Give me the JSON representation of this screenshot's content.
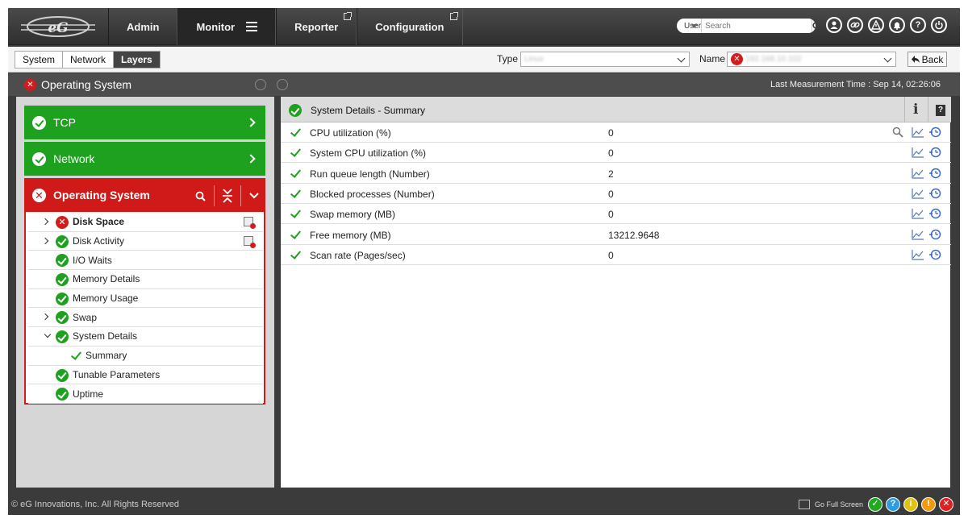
{
  "app": {
    "brand": "eG"
  },
  "nav": {
    "items": [
      {
        "label": "Admin",
        "active": false,
        "external": false
      },
      {
        "label": "Monitor",
        "active": true,
        "external": false
      },
      {
        "label": "Reporter",
        "active": false,
        "external": true
      },
      {
        "label": "Configuration",
        "active": false,
        "external": true
      }
    ],
    "search_scope": "User",
    "search_placeholder": "Search",
    "icons": [
      "user-icon",
      "link-icon",
      "alert-triangle-icon",
      "bell-icon",
      "help-icon",
      "power-icon"
    ]
  },
  "subbar": {
    "tabs": [
      {
        "label": "System",
        "active": false
      },
      {
        "label": "Network",
        "active": false
      },
      {
        "label": "Layers",
        "active": true
      }
    ],
    "type_label": "Type",
    "type_value": "Linux",
    "name_label": "Name",
    "name_value": "192.168.10.102",
    "back_label": "Back"
  },
  "layer_bar": {
    "title": "Operating System",
    "status": "error",
    "measurement_time": "Last Measurement Time : Sep 14, 02:26:06"
  },
  "layers": [
    {
      "label": "TCP",
      "status": "ok"
    },
    {
      "label": "Network",
      "status": "ok"
    }
  ],
  "expanded_layer": {
    "label": "Operating System",
    "status": "error",
    "tests": [
      {
        "label": "Disk Space",
        "status": "error",
        "expander": "right",
        "bold": true,
        "has_action": true
      },
      {
        "label": "Disk Activity",
        "status": "ok",
        "expander": "right",
        "bold": false,
        "has_action": true
      },
      {
        "label": "I/O Waits",
        "status": "ok",
        "expander": "none",
        "bold": false,
        "has_action": false
      },
      {
        "label": "Memory Details",
        "status": "ok",
        "expander": "none",
        "bold": false,
        "has_action": false
      },
      {
        "label": "Memory Usage",
        "status": "ok",
        "expander": "none",
        "bold": false,
        "has_action": false
      },
      {
        "label": "Swap",
        "status": "ok",
        "expander": "right",
        "bold": false,
        "has_action": false
      },
      {
        "label": "System Details",
        "status": "ok",
        "expander": "down",
        "bold": false,
        "has_action": false
      },
      {
        "label": "Summary",
        "status": "tick",
        "expander": "none",
        "bold": false,
        "has_action": false,
        "child": true
      },
      {
        "label": "Tunable Parameters",
        "status": "ok",
        "expander": "none",
        "bold": false,
        "has_action": false
      },
      {
        "label": "Uptime",
        "status": "ok",
        "expander": "none",
        "bold": false,
        "has_action": false
      }
    ]
  },
  "details": {
    "title": "System Details - Summary",
    "measures": [
      {
        "name": "CPU utilization (%)",
        "value": "0",
        "has_search": true
      },
      {
        "name": "System CPU utilization (%)",
        "value": "0",
        "has_search": false
      },
      {
        "name": "Run queue length (Number)",
        "value": "2",
        "has_search": false
      },
      {
        "name": "Blocked processes (Number)",
        "value": "0",
        "has_search": false
      },
      {
        "name": "Swap memory (MB)",
        "value": "0",
        "has_search": false
      },
      {
        "name": "Free memory (MB)",
        "value": "13212.9648",
        "has_search": false
      },
      {
        "name": "Scan rate (Pages/sec)",
        "value": "0",
        "has_search": false
      }
    ]
  },
  "footer": {
    "copyright": "© eG Innovations, Inc. All Rights Reserved",
    "fullscreen_label": "Go Full Screen",
    "status_dots": [
      {
        "name": "normal",
        "color": "#22a822",
        "glyph": "✓"
      },
      {
        "name": "info",
        "color": "#2d9ce0",
        "glyph": "?"
      },
      {
        "name": "minor",
        "color": "#e2c210",
        "glyph": "i"
      },
      {
        "name": "major",
        "color": "#f09a10",
        "glyph": "!"
      },
      {
        "name": "critical",
        "color": "#e02020",
        "glyph": "✕"
      }
    ]
  },
  "colors": {
    "ok": "#1ea11e",
    "error": "#d01a1a",
    "accent": "#3a6ac0"
  }
}
